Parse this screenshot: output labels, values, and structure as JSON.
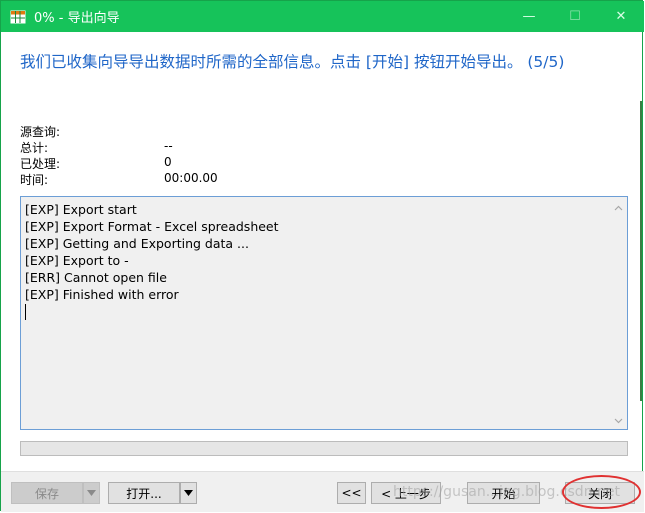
{
  "window": {
    "title": "0% - 导出向导",
    "minimize_glyph": "—",
    "maximize_glyph": "☐",
    "close_glyph": "✕"
  },
  "heading": "我们已收集向导导出数据时所需的全部信息。点击 [开始] 按钮开始导出。 (5/5)",
  "info": {
    "source_query_label": "源查询:",
    "source_query_value": "",
    "total_label": "总计:",
    "total_value": "--",
    "processed_label": "已处理:",
    "processed_value": "0",
    "time_label": "时间:",
    "time_value": "00:00.00"
  },
  "log": [
    "[EXP] Export start",
    "[EXP] Export Format - Excel spreadsheet",
    "[EXP] Getting and Exporting data ...",
    "[EXP] Export to -",
    "[ERR] Cannot open file",
    "[EXP] Finished with error"
  ],
  "progress": {
    "percent": 0
  },
  "buttons": {
    "save": "保存",
    "open": "打开...",
    "first": "<<",
    "prev": "< 上一步",
    "start": "开始",
    "close": "关闭"
  },
  "watermark": "https://gusan...ing.blog.csdn.net",
  "colors": {
    "titlebar": "#16c35a",
    "heading": "#1f66c8",
    "log_border": "#6c9ed6",
    "highlight": "#e03131"
  },
  "icons": {
    "app": "table-grid-icon",
    "scroll_up": "chevron-up-icon",
    "scroll_down": "chevron-down-icon",
    "dropdown": "triangle-down-icon"
  }
}
